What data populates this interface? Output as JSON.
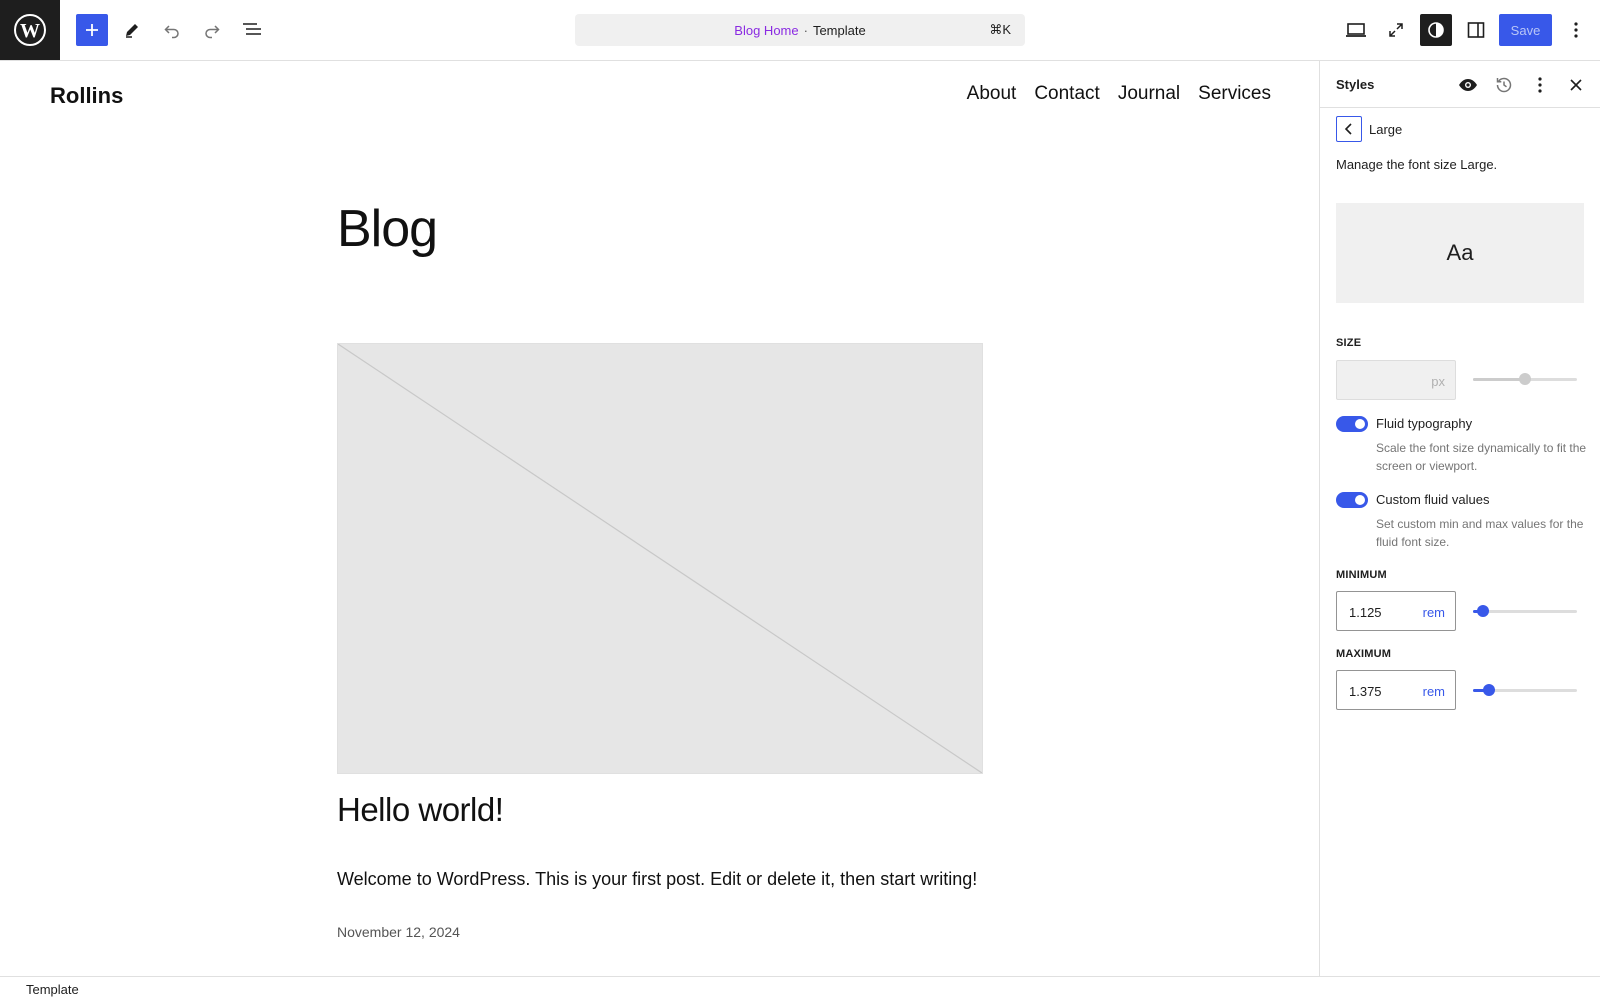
{
  "toolbar": {
    "logo_icon": "wordpress-logo-icon",
    "add_icon": "plus-icon",
    "tools_icon": "pencil-icon",
    "undo_icon": "undo-icon",
    "redo_icon": "redo-icon",
    "list_view_icon": "list-view-icon",
    "document_title": "Blog Home",
    "document_separator": "·",
    "document_type": "Template",
    "command_shortcut": "⌘K",
    "view_icon": "desktop-icon",
    "expand_icon": "fullscreen-icon",
    "styles_icon": "contrast-icon",
    "sidebar_icon": "sidebar-icon",
    "save_label": "Save",
    "more_icon": "more-vertical-icon",
    "accent_color": "#3858e9"
  },
  "canvas": {
    "site_title": "Rollins",
    "nav": [
      "About",
      "Contact",
      "Journal",
      "Services"
    ],
    "page_heading": "Blog",
    "post": {
      "title": "Hello world!",
      "excerpt": "Welcome to WordPress. This is your first post. Edit or delete it, then start writing!",
      "date": "November 12, 2024"
    }
  },
  "sidebar": {
    "title": "Styles",
    "header_icons": [
      "eye-icon",
      "revisions-icon",
      "more-vertical-icon",
      "close-icon"
    ],
    "back_icon": "chevron-left-icon",
    "panel_title": "Large",
    "panel_description": "Manage the font size Large.",
    "preview_text": "Aa",
    "size": {
      "label": "SIZE",
      "value": "",
      "unit": "px",
      "slider_fraction": 0.5
    },
    "fluid_typography": {
      "label": "Fluid typography",
      "help": "Scale the font size dynamically to fit the screen or viewport.",
      "enabled": true
    },
    "custom_fluid_values": {
      "label": "Custom fluid values",
      "help": "Set custom min and max values for the fluid font size.",
      "enabled": true
    },
    "minimum": {
      "label": "MINIMUM",
      "value": "1.125",
      "unit": "rem",
      "slider_fraction": 0.1
    },
    "maximum": {
      "label": "MAXIMUM",
      "value": "1.375",
      "unit": "rem",
      "slider_fraction": 0.15
    }
  },
  "footer": {
    "breadcrumb": "Template"
  }
}
